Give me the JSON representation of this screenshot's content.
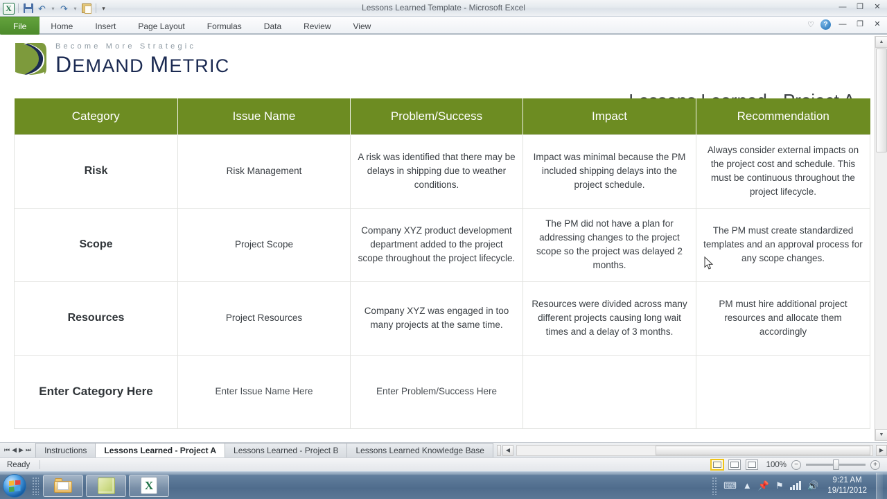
{
  "window": {
    "title": "Lessons Learned Template - Microsoft Excel",
    "minimize": "—",
    "restore": "❐",
    "close": "✕"
  },
  "quick_access": {
    "app_icon": "excel-icon",
    "save": "save-icon",
    "undo": "undo-icon",
    "redo": "redo-icon",
    "paste": "paste-icon",
    "customize": "▾"
  },
  "ribbon": {
    "tabs": [
      {
        "label": "File"
      },
      {
        "label": "Home"
      },
      {
        "label": "Insert"
      },
      {
        "label": "Page Layout"
      },
      {
        "label": "Formulas"
      },
      {
        "label": "Data"
      },
      {
        "label": "Review"
      },
      {
        "label": "View"
      }
    ],
    "help_label": "?",
    "minimize_ribbon": "—",
    "restore_ribbon": "❐",
    "close_ribbon": "✕"
  },
  "brand": {
    "tagline": "Become More Strategic",
    "name_part1": "D",
    "name_part1_rest": "EMAND",
    "name_part2": "M",
    "name_part2_rest": "ETRIC"
  },
  "document": {
    "title": "Lessons Learned - Project A"
  },
  "table": {
    "headers": [
      "Category",
      "Issue Name",
      "Problem/Success",
      "Impact",
      "Recommendation"
    ],
    "rows": [
      {
        "category": "Risk",
        "issue_name": "Risk Management",
        "problem_success": "A risk was identified that there may be delays in shipping due to weather conditions.",
        "impact": "Impact was minimal because the PM included shipping delays into the project schedule.",
        "recommendation": "Always consider external impacts on the project cost and schedule. This must be continuous throughout the project lifecycle."
      },
      {
        "category": "Scope",
        "issue_name": "Project Scope",
        "problem_success": "Company XYZ product development department added to the project scope throughout the project lifecycle.",
        "impact": "The PM did not have a plan for addressing changes to the project scope so the project was delayed 2 months.",
        "recommendation": "The PM must create standardized templates and an approval process for any scope changes."
      },
      {
        "category": "Resources",
        "issue_name": "Project Resources",
        "problem_success": "Company XYZ was engaged in too many projects at the same time.",
        "impact": "Resources were divided across many different projects causing long wait times and a delay of 3 months.",
        "recommendation": "PM must hire additional project resources and allocate them accordingly"
      },
      {
        "category": "Enter Category Here",
        "issue_name": "Enter Issue Name Here",
        "problem_success": "Enter Problem/Success Here",
        "impact": "",
        "recommendation": ""
      }
    ]
  },
  "sheet_tabs": {
    "first": "⏮",
    "prev": "◀",
    "next": "▶",
    "last": "⏭",
    "items": [
      {
        "label": "Instructions",
        "active": false
      },
      {
        "label": "Lessons Learned - Project A",
        "active": true
      },
      {
        "label": "Lessons Learned - Project B",
        "active": false
      },
      {
        "label": "Lessons Learned Knowledge Base",
        "active": false
      }
    ],
    "scroll_left": "◀",
    "scroll_right": "▶"
  },
  "status_bar": {
    "mode": "Ready",
    "view_normal": "normal-view-icon",
    "view_page_layout": "page-layout-view-icon",
    "view_page_break": "page-break-view-icon",
    "zoom": "100%",
    "zoom_out": "−",
    "zoom_in": "+"
  },
  "taskbar": {
    "start": "start-orb",
    "buttons": [
      {
        "name": "windows-explorer",
        "icon": "folder-icon"
      },
      {
        "name": "sticky-notes",
        "icon": "notes-icon"
      },
      {
        "name": "microsoft-excel",
        "icon": "excel-icon"
      }
    ],
    "tray": {
      "keyboard": "⌨",
      "show_hidden": "▲",
      "network_pin": "📌",
      "action_center": "⚑",
      "signal": "signal-icon",
      "volume": "🔊",
      "time": "9:21 AM",
      "date": "19/11/2012"
    }
  },
  "colors": {
    "header_green": "#6d8c22",
    "file_tab_green": "#4c8a2b",
    "brand_navy": "#1b2a52",
    "brand_olive": "#7d9a3c"
  }
}
